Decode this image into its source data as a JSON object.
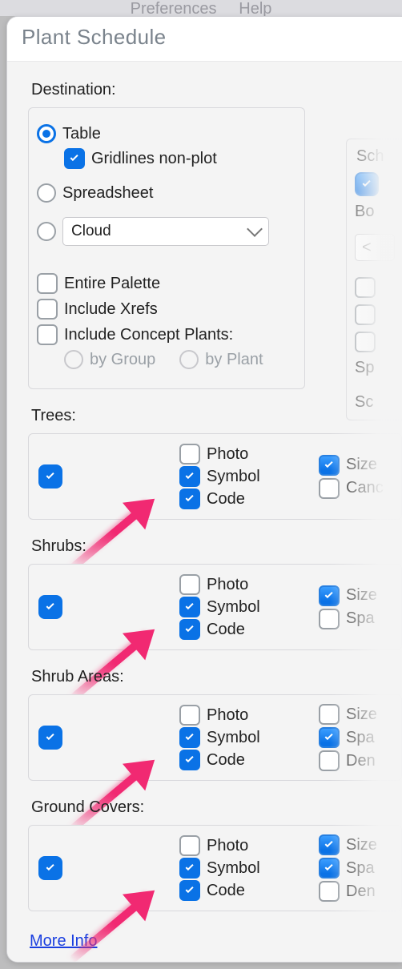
{
  "menubar": {
    "item1": "Preferences",
    "item2": "Help"
  },
  "dialog_title": "Plant Schedule",
  "destination": {
    "label": "Destination:",
    "table": {
      "label": "Table",
      "checked": true
    },
    "gridlines": {
      "label": "Gridlines non-plot",
      "checked": true
    },
    "spreadsheet": {
      "label": "Spreadsheet",
      "checked": false
    },
    "cloud": {
      "label": "Cloud",
      "selected": "Cloud",
      "radio_checked": false
    },
    "entire_palette": {
      "label": "Entire Palette",
      "checked": false
    },
    "include_xrefs": {
      "label": "Include Xrefs",
      "checked": false
    },
    "include_concept": {
      "label": "Include Concept Plants:",
      "checked": false
    },
    "by_group": {
      "label": "by Group"
    },
    "by_plant": {
      "label": "by Plant"
    }
  },
  "right_panel": {
    "sch_label": "Sch",
    "top_cb_checked": true,
    "bo_label": "Bo",
    "input_placeholder": "<",
    "sp_label": "Sp",
    "sc_label": "Sc"
  },
  "categories": [
    {
      "label": "Trees:",
      "main_checked": true,
      "photo": {
        "label": "Photo",
        "checked": false
      },
      "symbol": {
        "label": "Symbol",
        "checked": true
      },
      "code": {
        "label": "Code",
        "checked": true
      },
      "arrow": true,
      "right": [
        {
          "label": "Size",
          "checked": true,
          "gradient": true
        },
        {
          "label": "Canc",
          "checked": false
        }
      ]
    },
    {
      "label": "Shrubs:",
      "main_checked": true,
      "photo": {
        "label": "Photo",
        "checked": false
      },
      "symbol": {
        "label": "Symbol",
        "checked": true
      },
      "code": {
        "label": "Code",
        "checked": true
      },
      "arrow": true,
      "right": [
        {
          "label": "Size",
          "checked": true,
          "gradient": true
        },
        {
          "label": "Spa",
          "checked": false
        }
      ]
    },
    {
      "label": "Shrub Areas:",
      "main_checked": true,
      "photo": {
        "label": "Photo",
        "checked": false
      },
      "symbol": {
        "label": "Symbol",
        "checked": true
      },
      "code": {
        "label": "Code",
        "checked": true
      },
      "arrow": true,
      "right": [
        {
          "label": "Size",
          "checked": false
        },
        {
          "label": "Spa",
          "checked": true,
          "gradient": true
        },
        {
          "label": "Den",
          "checked": false
        }
      ]
    },
    {
      "label": "Ground Covers:",
      "main_checked": true,
      "photo": {
        "label": "Photo",
        "checked": false
      },
      "symbol": {
        "label": "Symbol",
        "checked": true
      },
      "code": {
        "label": "Code",
        "checked": true
      },
      "arrow": true,
      "right": [
        {
          "label": "Size",
          "checked": true,
          "gradient": true
        },
        {
          "label": "Spa",
          "checked": true,
          "gradient": true
        },
        {
          "label": "Den",
          "checked": false
        }
      ]
    }
  ],
  "more_info": "More Info"
}
